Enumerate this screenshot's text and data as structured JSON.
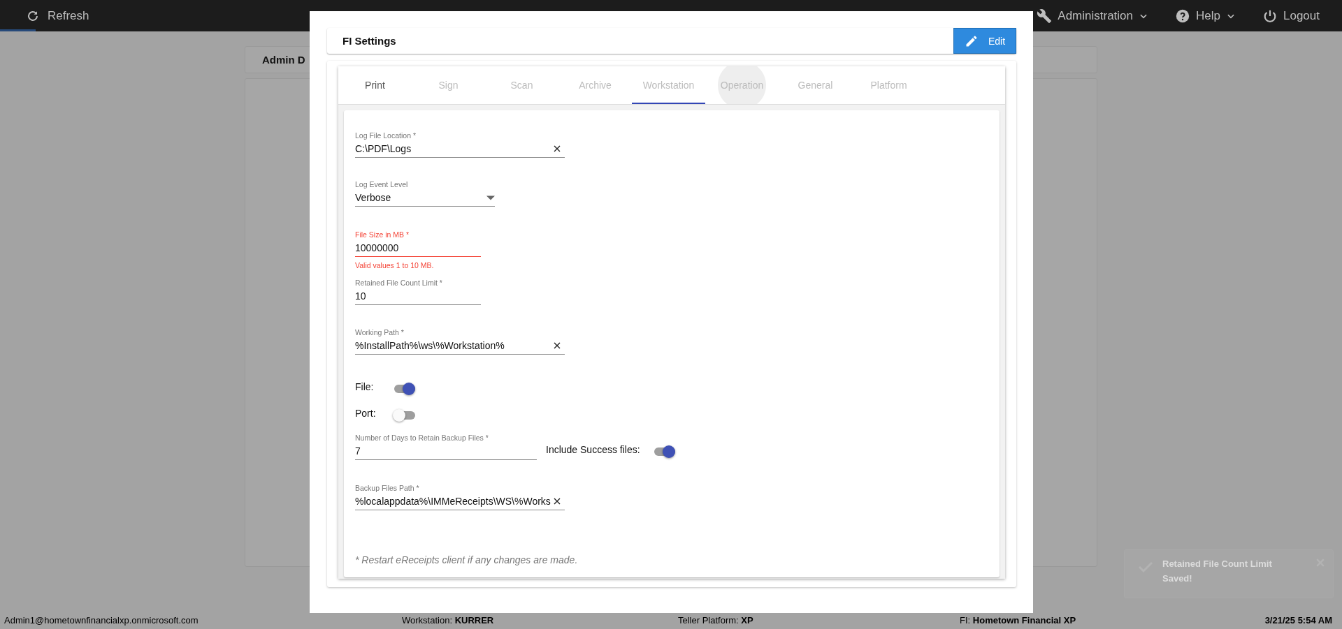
{
  "top_bar": {
    "refresh": "Refresh",
    "menus": [
      {
        "label": "Administration"
      },
      {
        "label": "Help"
      },
      {
        "label": "Logout"
      }
    ]
  },
  "page": {
    "card_title": "Admin D"
  },
  "toast": {
    "title": "Retained File Count Limit",
    "message": "Saved!"
  },
  "status_bar": {
    "user": "Admin1@hometownfinancialxp.onmicrosoft.com",
    "items": [
      {
        "label": "Workstation:",
        "value": "KURRER"
      },
      {
        "label": "Teller Platform:",
        "value": "XP"
      },
      {
        "label": "FI:",
        "value": "Hometown Financial XP"
      }
    ],
    "datetime": "3/21/25 5:54 AM"
  },
  "dialog": {
    "title": "FI Settings",
    "edit_button": "Edit",
    "tabs": [
      {
        "label": "Print",
        "selected": false,
        "disabled": false,
        "focused": false
      },
      {
        "label": "Sign",
        "selected": false,
        "disabled": true,
        "focused": false
      },
      {
        "label": "Scan",
        "selected": false,
        "disabled": true,
        "focused": false
      },
      {
        "label": "Archive",
        "selected": false,
        "disabled": true,
        "focused": false
      },
      {
        "label": "Workstation",
        "selected": true,
        "disabled": true,
        "focused": false
      },
      {
        "label": "Operation",
        "selected": false,
        "disabled": true,
        "focused": true
      },
      {
        "label": "General",
        "selected": false,
        "disabled": true,
        "focused": false
      },
      {
        "label": "Platform",
        "selected": false,
        "disabled": true,
        "focused": false
      }
    ],
    "form": {
      "log_file_location": {
        "label": "Log File Location *",
        "value": "C:\\PDF\\Logs",
        "clearable": true,
        "error": false
      },
      "log_event_level": {
        "label": "Log Event Level",
        "value": "Verbose",
        "error": false
      },
      "file_size": {
        "label": "File Size in MB *",
        "value": "10000000",
        "error": true,
        "helper": "Valid values 1 to 10 MB."
      },
      "retained_file_count": {
        "label": "Retained File Count Limit *",
        "value": "10",
        "error": false
      },
      "working_path": {
        "label": "Working Path *",
        "value": "%InstallPath%\\ws\\%Workstation%",
        "clearable": true,
        "error": false
      },
      "file_toggle": {
        "label": "File:",
        "on": true
      },
      "port_toggle": {
        "label": "Port:",
        "on": false
      },
      "backup_days": {
        "label": "Number of Days to Retain Backup Files *",
        "value": "7",
        "error": false
      },
      "include_success": {
        "label": "Include Success files:",
        "on": true
      },
      "backup_files_path": {
        "label": "Backup Files Path *",
        "value": "%localappdata%\\IMMeReceipts\\WS\\%Works",
        "clearable": true,
        "error": false
      },
      "note": "* Restart eReceipts client if any changes are made."
    }
  }
}
